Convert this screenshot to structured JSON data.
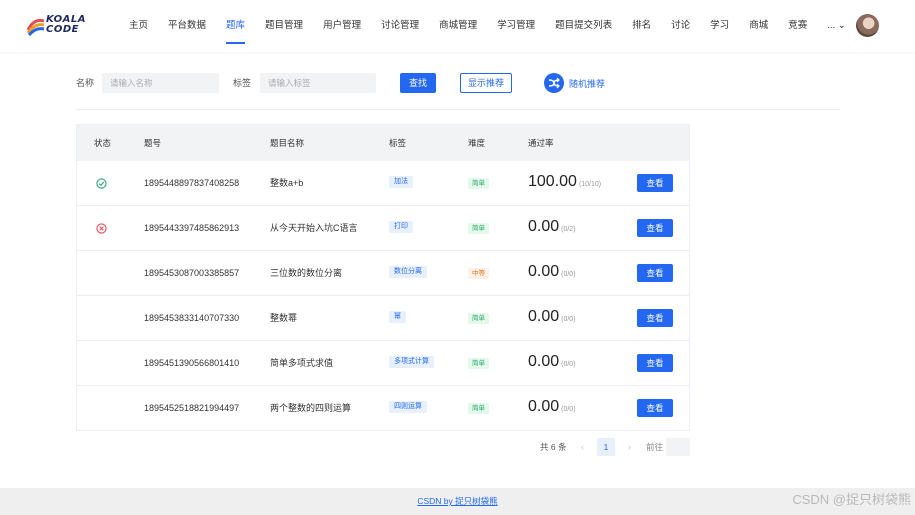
{
  "logo": {
    "line1": "KOALA",
    "line2": "CODE"
  },
  "nav": {
    "items": [
      "主页",
      "平台数据",
      "题库",
      "题目管理",
      "用户管理",
      "讨论管理",
      "商城管理",
      "学习管理",
      "题目提交列表",
      "排名",
      "讨论",
      "学习",
      "商城",
      "竞赛"
    ],
    "active": "题库",
    "more": "... ⌄"
  },
  "search": {
    "name_label": "名称",
    "name_placeholder": "请输入名称",
    "tag_label": "标签",
    "tag_placeholder": "请输入标签",
    "search_button": "查找",
    "recommend_button": "显示推荐",
    "random_label": "随机推荐"
  },
  "table": {
    "headers": {
      "status": "状态",
      "id": "题号",
      "name": "题目名称",
      "tag": "标签",
      "difficulty": "难度",
      "pass_rate": "通过率"
    },
    "rows": [
      {
        "status": "passed",
        "id": "1895448897837408258",
        "name": "整数a+b",
        "tag": "加法",
        "difficulty": "简单",
        "difficulty_level": "easy",
        "rate": "100.00",
        "ratio": "(10/10)",
        "action": "查看"
      },
      {
        "status": "failed",
        "id": "1895443397485862913",
        "name": "从今天开始入坑C语言",
        "tag": "打印",
        "difficulty": "简单",
        "difficulty_level": "easy",
        "rate": "0.00",
        "ratio": "(0/2)",
        "action": "查看"
      },
      {
        "status": "none",
        "id": "1895453087003385857",
        "name": "三位数的数位分离",
        "tag": "数位分离",
        "difficulty": "中等",
        "difficulty_level": "medium",
        "rate": "0.00",
        "ratio": "(0/0)",
        "action": "查看"
      },
      {
        "status": "none",
        "id": "1895453833140707330",
        "name": "整数幂",
        "tag": "幂",
        "difficulty": "简单",
        "difficulty_level": "easy",
        "rate": "0.00",
        "ratio": "(0/0)",
        "action": "查看"
      },
      {
        "status": "none",
        "id": "1895451390566801410",
        "name": "简单多项式求值",
        "tag": "多项式计算",
        "difficulty": "简单",
        "difficulty_level": "easy",
        "rate": "0.00",
        "ratio": "(0/0)",
        "action": "查看"
      },
      {
        "status": "none",
        "id": "1895452518821994497",
        "name": "两个整数的四则运算",
        "tag": "四则运算",
        "difficulty": "简单",
        "difficulty_level": "easy",
        "rate": "0.00",
        "ratio": "(0/0)",
        "action": "查看"
      }
    ]
  },
  "pagination": {
    "total": "共 6 条",
    "prev": "‹",
    "current": "1",
    "next": "›",
    "goto": "前往"
  },
  "footer": {
    "link": "CSDN by 捉只树袋熊"
  },
  "watermark": "CSDN @捉只树袋熊",
  "colors": {
    "primary": "#2468f2",
    "success": "#2ba471",
    "danger": "#e34d59",
    "warning": "#e37318"
  }
}
